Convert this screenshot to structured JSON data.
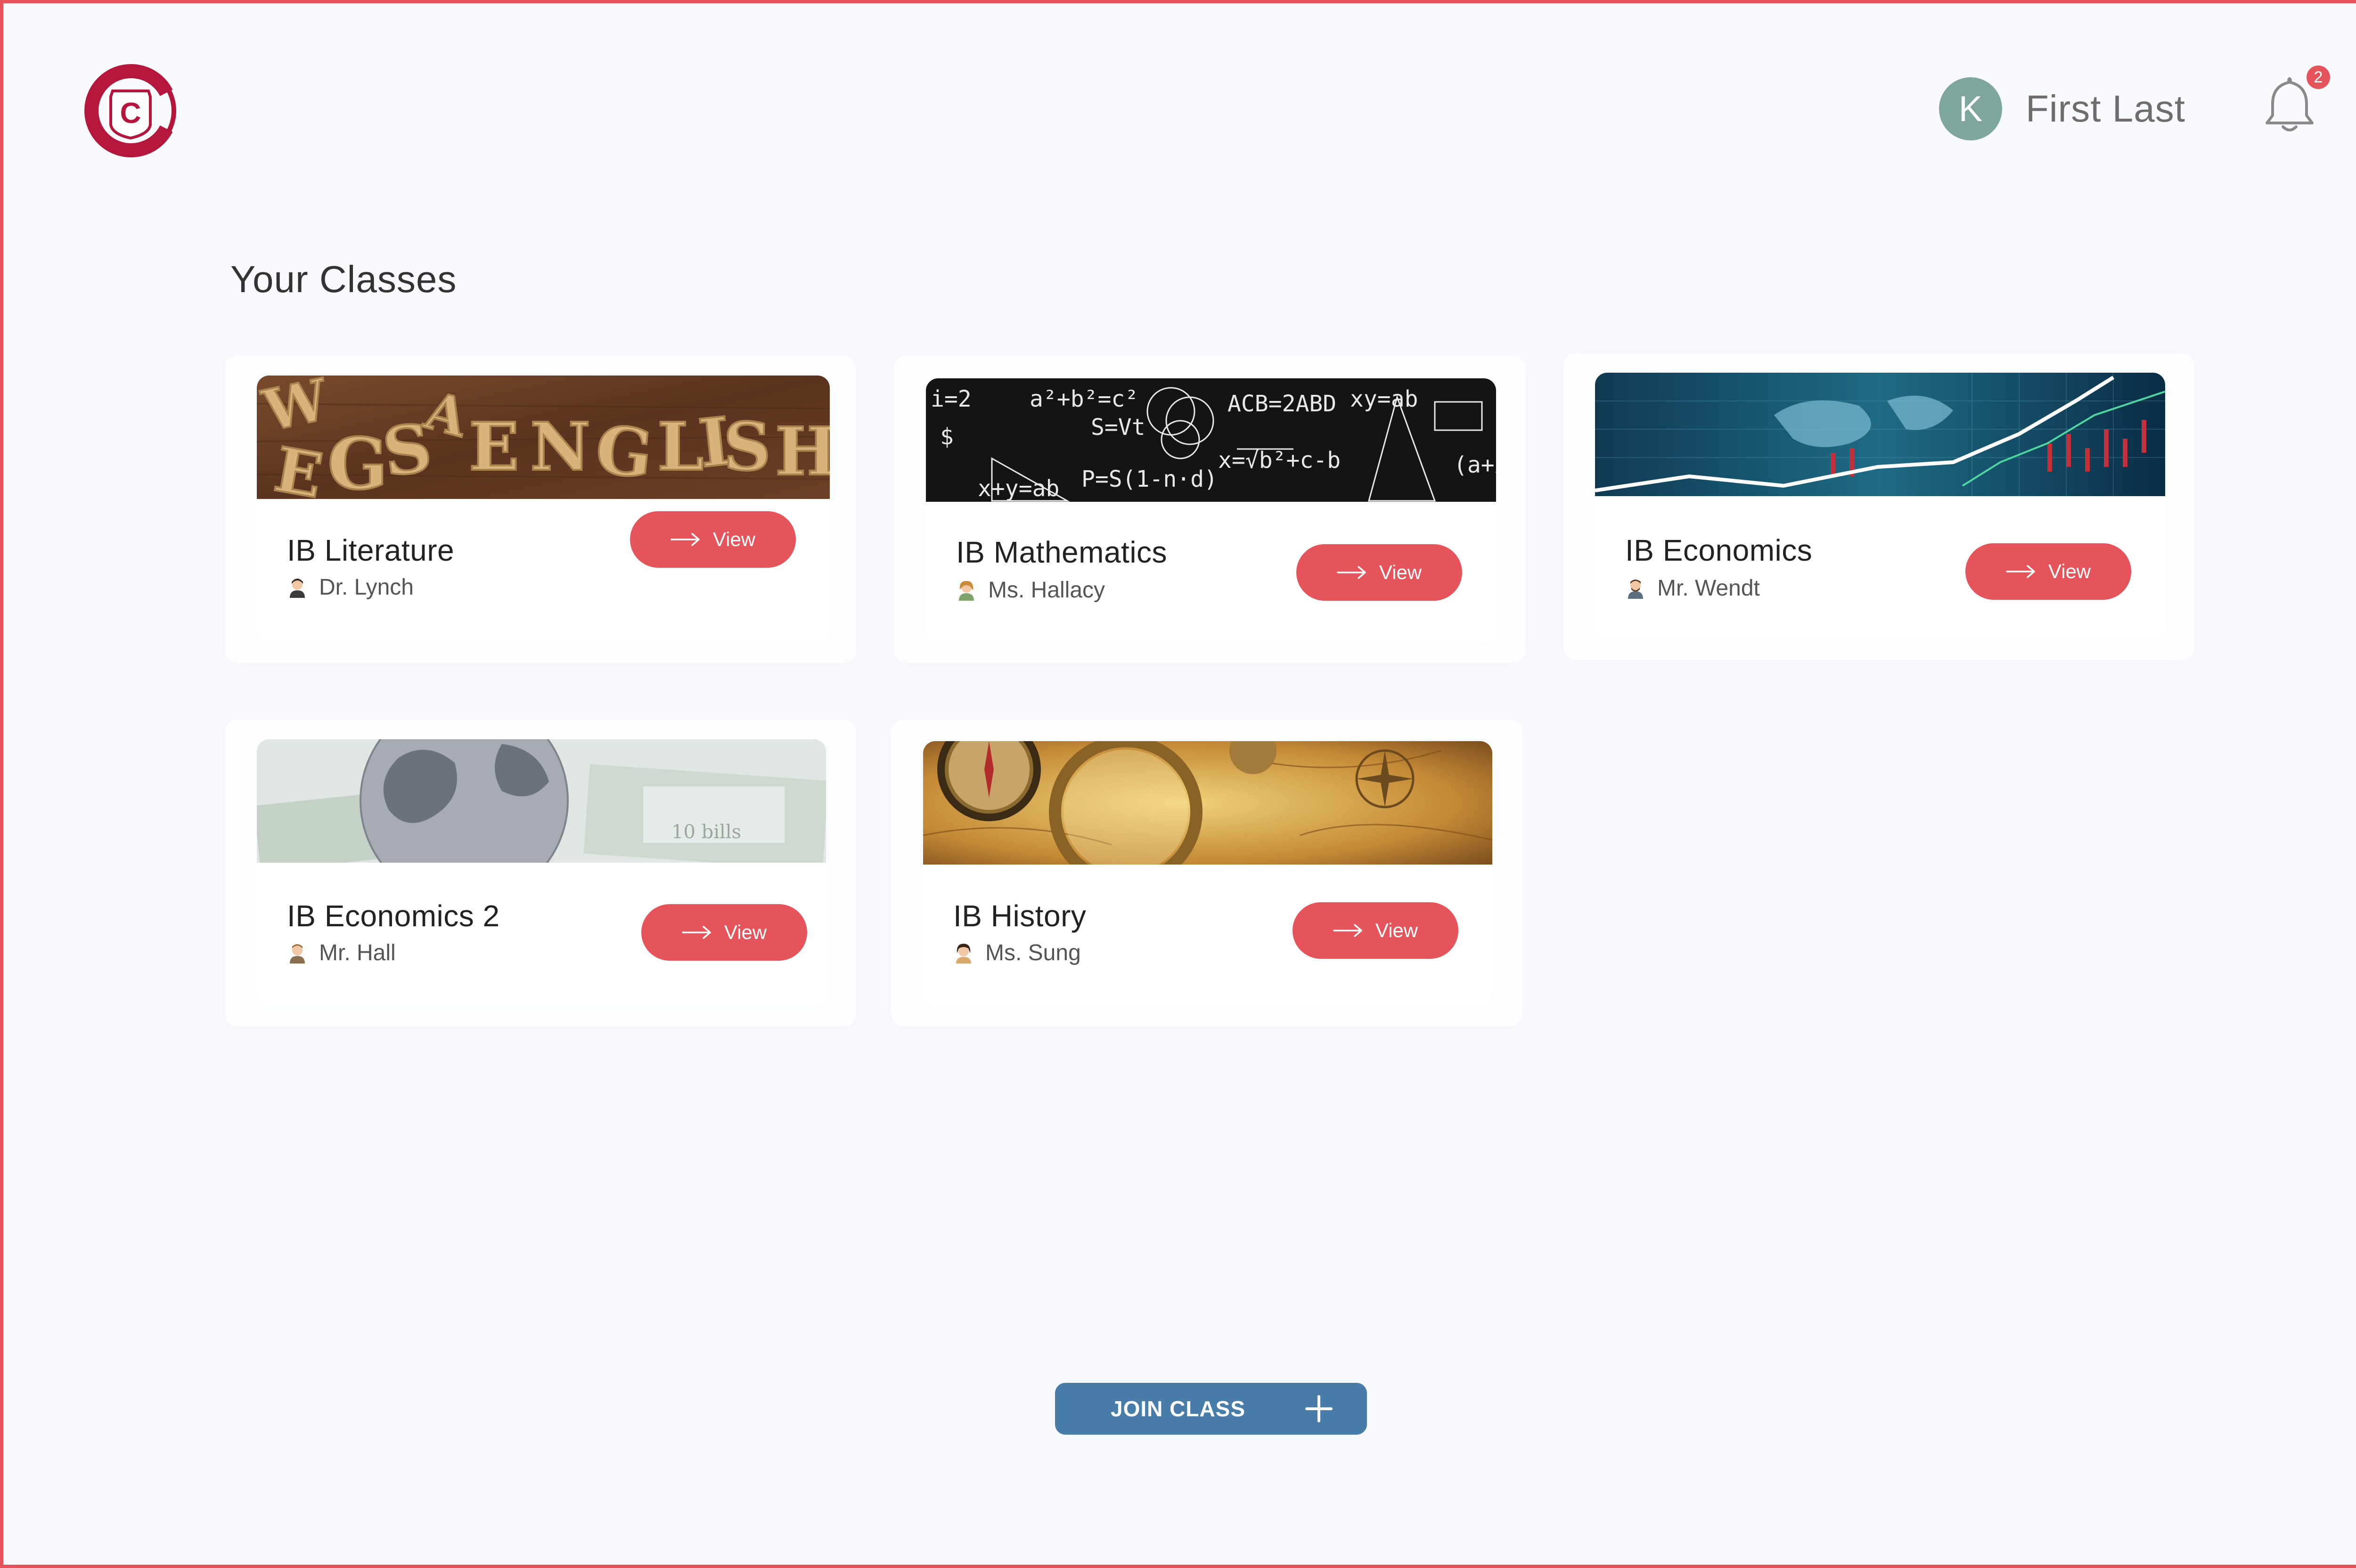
{
  "header": {
    "logo_letter": "C",
    "user": {
      "initial": "K",
      "name": "First Last"
    },
    "notifications": {
      "count": "2",
      "icon": "bell-icon"
    }
  },
  "page": {
    "title": "Your Classes"
  },
  "classes": [
    {
      "name": "IB Literature",
      "teacher": "Dr. Lynch",
      "button": "View",
      "banner": "english-letters"
    },
    {
      "name": "IB Mathematics",
      "teacher": "Ms. Hallacy",
      "button": "View",
      "banner": "chalkboard-math"
    },
    {
      "name": "IB Economics",
      "teacher": "Mr. Wendt",
      "button": "View",
      "banner": "world-market-chart"
    },
    {
      "name": "IB Economics 2",
      "teacher": "Mr. Hall",
      "button": "View",
      "banner": "globe-on-money"
    },
    {
      "name": "IB History",
      "teacher": "Ms. Sung",
      "button": "View",
      "banner": "compass-map"
    }
  ],
  "actions": {
    "join_class": "JOIN CLASS"
  },
  "colors": {
    "accent": "#e5545a",
    "primary": "#477da8",
    "avatar": "#7fa69d",
    "logo": "#b5163b"
  }
}
